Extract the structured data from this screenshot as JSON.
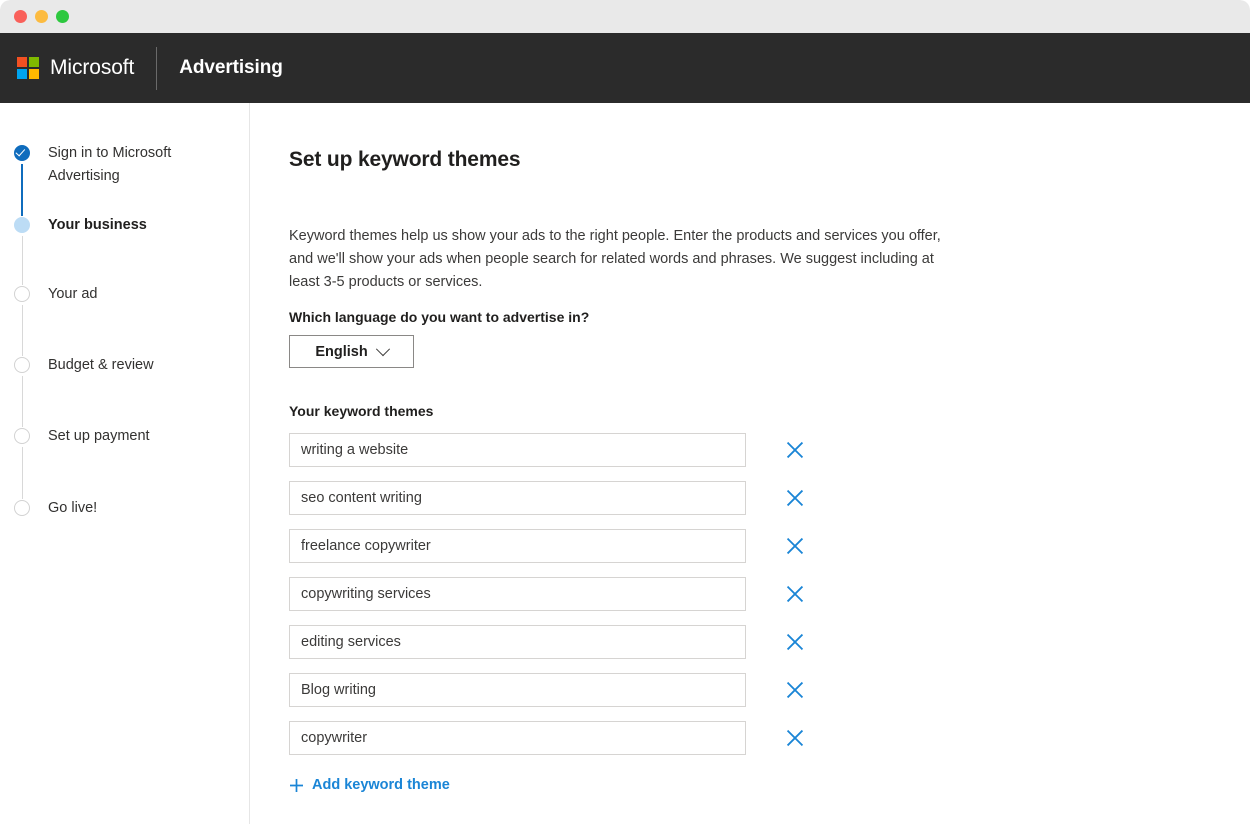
{
  "window": {
    "traffic_lights": [
      "close",
      "minimize",
      "zoom"
    ],
    "colors": {
      "close": "#f9605a",
      "minimize": "#fcbb40",
      "zoom": "#2dc83f",
      "titlebar_bg": "#e9e9e9",
      "header_bg": "#2b2b2b",
      "accent_blue": "#0f6cbd",
      "link_blue": "#1a85d6"
    }
  },
  "header": {
    "brand": "Microsoft",
    "product": "Advertising",
    "logo_colors": {
      "top_left": "#f25022",
      "top_right": "#7fba00",
      "bottom_left": "#00a4ef",
      "bottom_right": "#ffb900"
    }
  },
  "sidebar": {
    "steps": [
      {
        "label": "Sign in to Microsoft Advertising",
        "state": "done"
      },
      {
        "label": "Your business",
        "state": "current"
      },
      {
        "label": "Your ad",
        "state": "todo"
      },
      {
        "label": "Budget & review",
        "state": "todo"
      },
      {
        "label": "Set up payment",
        "state": "todo"
      },
      {
        "label": "Go live!",
        "state": "todo"
      }
    ]
  },
  "main": {
    "title": "Set up keyword themes",
    "intro": "Keyword themes help us show your ads to the right people. Enter the products and services you offer, and we'll show your ads when people search for related words and phrases. We suggest including at least 3-5 products or services.",
    "language": {
      "label": "Which language do you want to advertise in?",
      "selected": "English",
      "options": [
        "English"
      ]
    },
    "themes": {
      "label": "Your keyword themes",
      "placeholder": "",
      "items": [
        "writing a website",
        "seo content writing",
        "freelance copywriter",
        "copywriting services",
        "editing services",
        "Blog writing",
        "copywriter"
      ],
      "remove_icon": "close-icon",
      "add_label": "Add keyword theme",
      "add_icon": "plus-icon"
    }
  }
}
